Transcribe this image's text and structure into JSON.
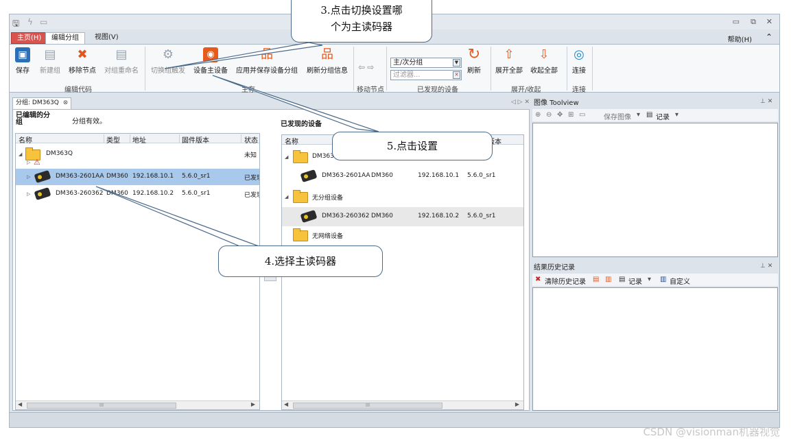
{
  "titlebar": {
    "quick_icons": [
      "save-icon",
      "lightning-icon",
      "monitor-icon"
    ],
    "window_controls": [
      "▭",
      "⧉",
      "✕"
    ]
  },
  "menu": {
    "home": "主页(H)",
    "edit_group": "编辑分组",
    "view": "视图(V)",
    "help": "帮助(H)",
    "collapse": "⌃"
  },
  "ribbon": {
    "buttons": {
      "save": "保存",
      "new_group": "新建组",
      "remove_node": "移除节点",
      "rename_group": "对组重命名",
      "switch_trigger": "切换组触发",
      "set_primary": "设备主设备",
      "apply_save": "应用并保存设备分组",
      "refresh_group": "刷新分组信息",
      "refresh": "刷新",
      "expand_all": "展开全部",
      "collapse_all": "收起全部",
      "connect": "连接"
    },
    "combo_value": "主/次分组",
    "filter_placeholder": "过滤器...",
    "groups": {
      "edit_code": "编辑代码",
      "main": "主存",
      "move_node": "移动节点",
      "found_devices": "已发现的设备",
      "expand_collapse": "展开/收起",
      "connect": "连接"
    }
  },
  "doc": {
    "tab_label": "分组: DM363Q",
    "nav": "◁ ▷ ✕"
  },
  "left_pane": {
    "title_line1": "已编辑的分",
    "title_line2": "组",
    "status": "分组有效。",
    "columns": [
      "名称",
      "类型",
      "地址",
      "固件版本",
      "状态"
    ],
    "group_row": {
      "name": "DM363Q",
      "state": "未知"
    },
    "devices": [
      {
        "name": "DM363-2601AA",
        "type": "DM360",
        "address": "192.168.10.1",
        "firmware": "5.6.0_sr1",
        "state": "已发现"
      },
      {
        "name": "DM363-260362",
        "type": "DM360",
        "address": "192.168.10.2",
        "firmware": "5.6.0_sr1",
        "state": "已发现"
      }
    ],
    "scroll_mark": "III"
  },
  "right_pane": {
    "title": "已发现的设备",
    "columns": [
      "名称",
      "固件版本"
    ],
    "group1": "DM363Q",
    "device1": {
      "name": "DM363-2601AA",
      "type": "DM360",
      "address": "192.168.10.1",
      "firmware": "5.6.0_sr1"
    },
    "group2": "无分组设备",
    "device2": {
      "name": "DM363-260362",
      "type": "DM360",
      "address": "192.168.10.2",
      "firmware": "5.6.0_sr1"
    },
    "group3": "无网络设备",
    "scroll_mark": "III"
  },
  "image_panel": {
    "title": "图像 Toolview",
    "pin": "⊥ ✕",
    "save_image": "保存图像",
    "record": "记录"
  },
  "history_panel": {
    "title": "结果历史记录",
    "pin": "⊥ ✕",
    "clear": "清除历史记录",
    "record": "记录",
    "custom": "自定义"
  },
  "callouts": {
    "c3_line1": "3.点击切换设置哪",
    "c3_line2": "个为主读码器",
    "c4": "4.选择主读码器",
    "c5": "5.点击设置"
  },
  "watermark": "CSDN @visionman机器视觉"
}
